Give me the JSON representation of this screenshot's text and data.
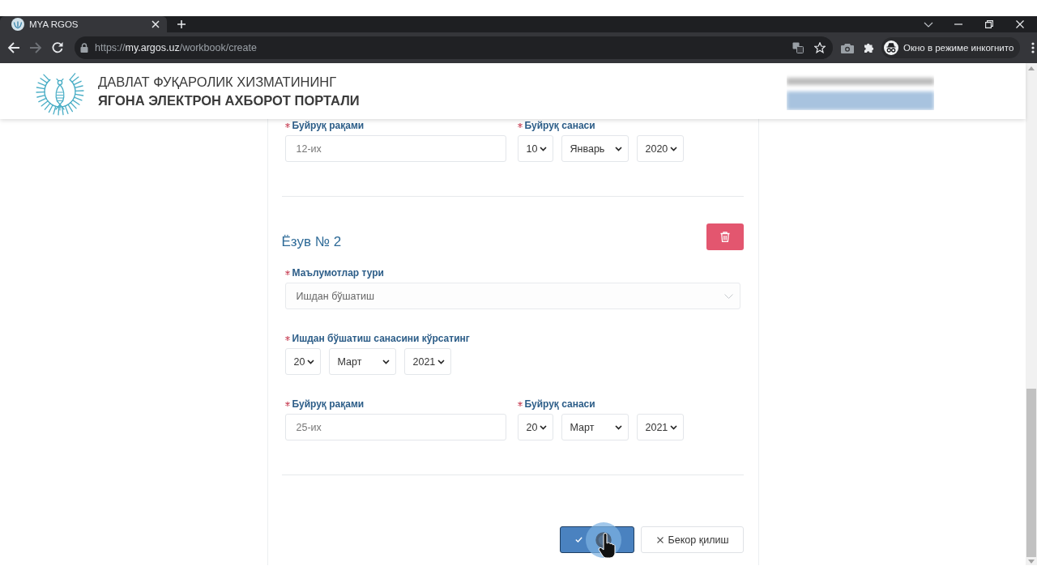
{
  "browser": {
    "tabs": [
      {
        "title": "MYA RGOS",
        "selected": true
      }
    ],
    "nav_buttons": [
      {
        "kind": "back",
        "disabled": false
      },
      {
        "kind": "forward",
        "disabled": true
      },
      {
        "kind": "reload",
        "disabled": false
      }
    ],
    "address": {
      "scheme": "https://",
      "host": "my.argos.uz",
      "path": "/workbook/create"
    },
    "profile": {
      "label": "Окно в режиме инкогнито"
    }
  },
  "header": {
    "title_lines": [
      {
        "text": "ДАВЛАТ ФУҚАРОЛИК ХИЗМАТИНИНГ",
        "bold": false
      },
      {
        "text": "ЯГОНА ЭЛЕКТРОН АХБОРОТ ПОРТАЛИ",
        "bold": true
      }
    ]
  },
  "form": {
    "sections": [
      {
        "rows": [
          [
            {
              "kind": "text",
              "label": "Буйруқ рақами",
              "required": true,
              "value": "12-их"
            },
            {
              "kind": "date",
              "label": "Буйруқ санаси",
              "required": true,
              "day": "10",
              "month": "Январь",
              "year": "2020"
            }
          ]
        ]
      },
      {
        "heading": "Ёзув № 2",
        "deletable": true,
        "rows": [
          [
            {
              "kind": "select",
              "label": "Маълумотлар тури",
              "required": true,
              "value": "Ишдан бўшатиш"
            }
          ],
          [
            {
              "kind": "date",
              "label": "Ишдан бўшатиш санасини кўрсатинг",
              "required": true,
              "day": "20",
              "month": "Март",
              "year": "2021"
            }
          ],
          [
            {
              "kind": "text",
              "label": "Буйруқ рақами",
              "required": true,
              "value": "25-их"
            },
            {
              "kind": "date",
              "label": "Буйруқ санаси",
              "required": true,
              "day": "20",
              "month": "Март",
              "year": "2021"
            }
          ]
        ]
      }
    ],
    "actions": [
      {
        "kind": "submit",
        "pressed": true
      },
      {
        "kind": "cancel",
        "label": "Бекор қилиш",
        "pressed": false
      }
    ]
  }
}
